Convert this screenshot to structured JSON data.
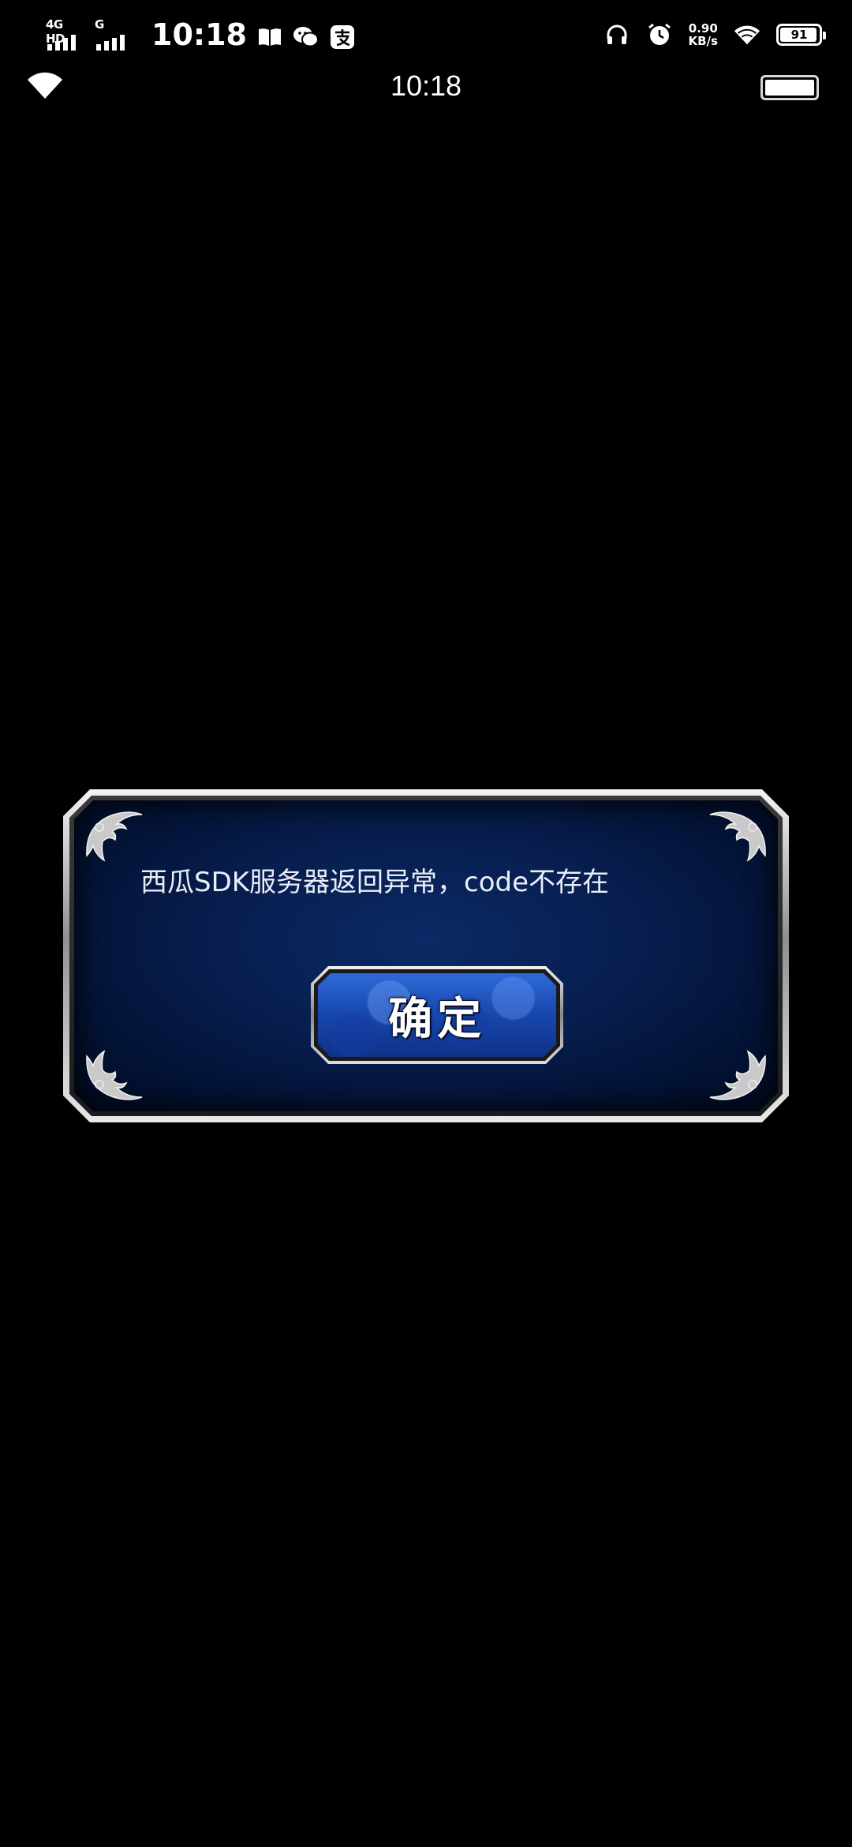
{
  "status_bar": {
    "network_type_1": "4G HD",
    "network_type_2": "G",
    "time": "10:18",
    "net_speed_value": "0.90",
    "net_speed_unit": "KB/s",
    "battery_level": "91",
    "icons": [
      "book-icon",
      "wechat-icon",
      "alipay-icon",
      "headphones-icon",
      "alarm-icon",
      "wifi-icon",
      "battery-icon"
    ]
  },
  "sub_bar": {
    "time": "10:18",
    "icons": [
      "wifi-icon",
      "battery-icon"
    ]
  },
  "dialog": {
    "message": "西瓜SDK服务器返回异常，code不存在",
    "confirm_label": "确定"
  },
  "colors": {
    "background": "#000000",
    "dialog_panel": "#071d4d",
    "button_face": "#1747ac",
    "frame_silver": "#c8c8c8"
  }
}
